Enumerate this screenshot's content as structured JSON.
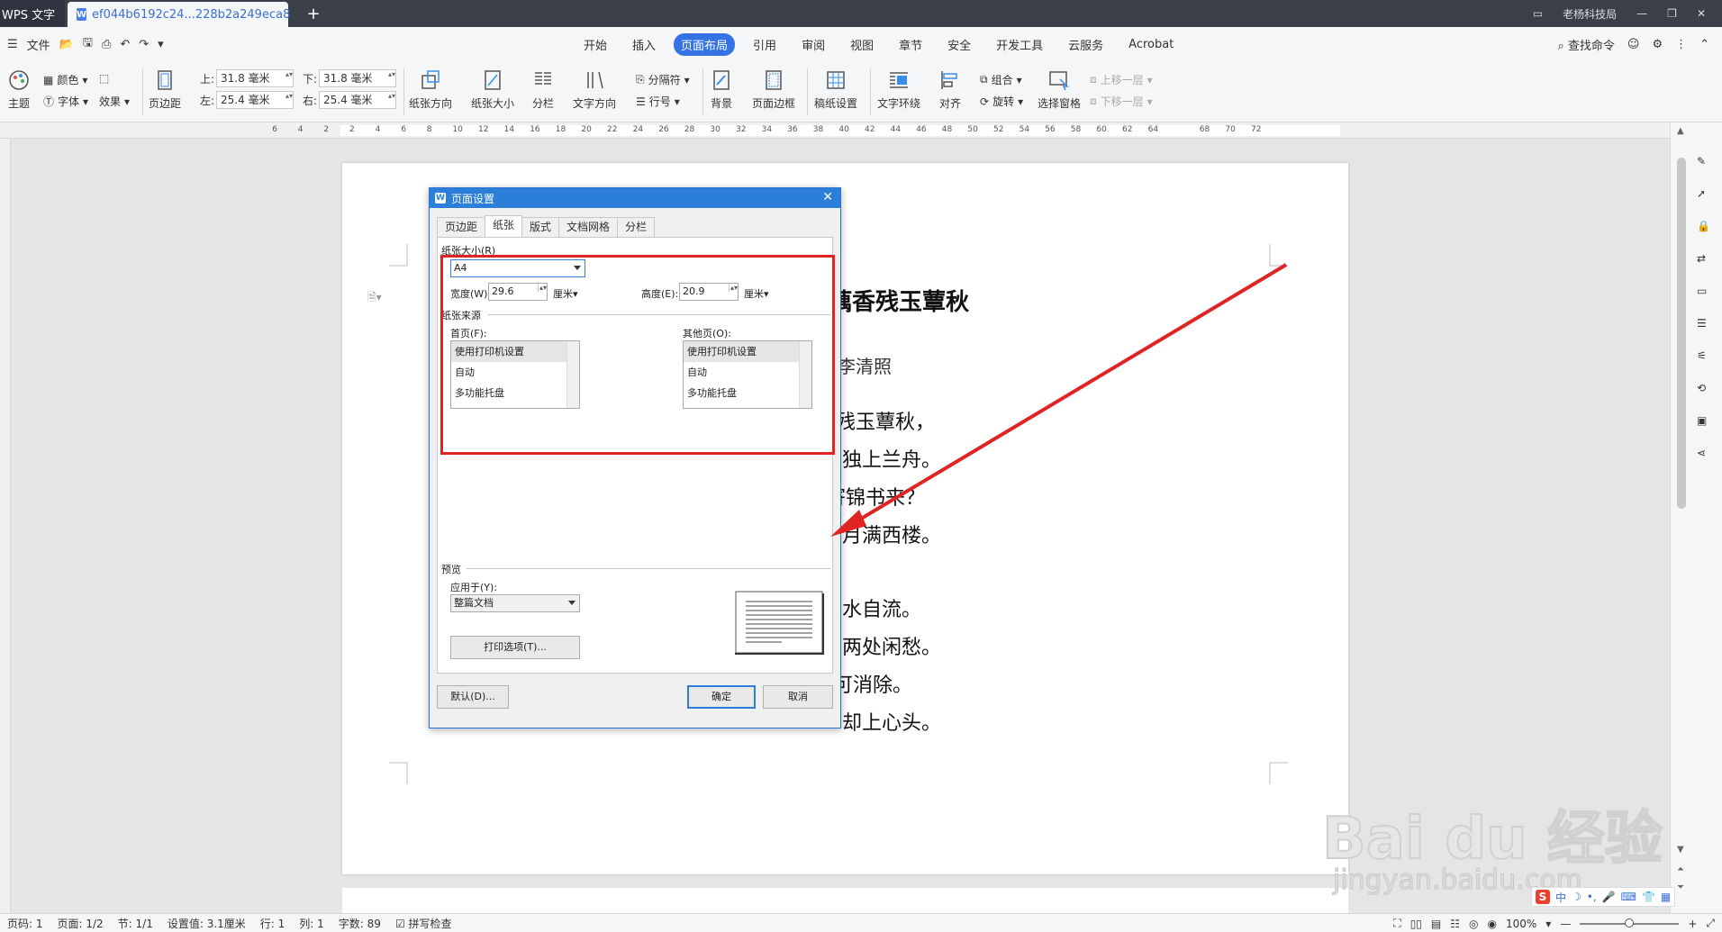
{
  "titlebar": {
    "app_tab": "WPS 文字",
    "doc_tab": "ef044b6192c24...228b2a249eca8",
    "user": "老杨科技局"
  },
  "menu": {
    "file": "文件",
    "tabs": [
      "开始",
      "插入",
      "页面布局",
      "引用",
      "审阅",
      "视图",
      "章节",
      "安全",
      "开发工具",
      "云服务",
      "Acrobat"
    ],
    "active_tab": "页面布局",
    "search": "查找命令"
  },
  "ribbon": {
    "theme": "主题",
    "color": "颜色",
    "font": "字体",
    "effect": "效果",
    "margins": "页边距",
    "top_label": "上:",
    "top_value": "31.8 毫米",
    "bottom_label": "下:",
    "bottom_value": "31.8 毫米",
    "left_label": "左:",
    "left_value": "25.4 毫米",
    "right_label": "右:",
    "right_value": "25.4 毫米",
    "orientation": "纸张方向",
    "size": "纸张大小",
    "columns": "分栏",
    "text_direction": "文字方向",
    "breaks": "分隔符",
    "line_numbers": "行号",
    "background": "背景",
    "page_border": "页面边框",
    "manuscript": "稿纸设置",
    "wrap": "文字环绕",
    "align": "对齐",
    "group": "组合",
    "rotate": "旋转",
    "selection_pane": "选择窗格",
    "bring_forward": "上移一层",
    "send_backward": "下移一层"
  },
  "ruler": {
    "numbers": [
      "6",
      "4",
      "2",
      "2",
      "4",
      "6",
      "8",
      "10",
      "12",
      "14",
      "16",
      "18",
      "20",
      "22",
      "24",
      "26",
      "28",
      "30",
      "32",
      "34",
      "36",
      "38",
      "40",
      "42",
      "44",
      "46",
      "48",
      "50",
      "52",
      "54",
      "56",
      "58",
      "60",
      "62",
      "64",
      "68",
      "70",
      "72"
    ]
  },
  "document": {
    "title": "藕香残玉蕈秋",
    "author": "李清照",
    "lines": [
      "残玉蕈秋，",
      "独上兰舟。",
      "寄锦书来？",
      "月满西楼。",
      "水自流。",
      "两处闲愁。",
      "可消除。",
      "却上心头。"
    ]
  },
  "dialog": {
    "title": "页面设置",
    "tabs": [
      "页边距",
      "纸张",
      "版式",
      "文档网格",
      "分栏"
    ],
    "active_tab": "纸张",
    "paper_size_label": "纸张大小(R)",
    "paper_size_value": "A4",
    "width_label": "宽度(W):",
    "width_value": "29.6",
    "width_unit": "厘米",
    "height_label": "高度(E):",
    "height_value": "20.9",
    "height_unit": "厘米",
    "paper_source_label": "纸张来源",
    "first_page_label": "首页(F):",
    "other_pages_label": "其他页(O):",
    "source_options": [
      "使用打印机设置",
      "自动",
      "多功能托盘"
    ],
    "preview_label": "预览",
    "apply_to_label": "应用于(Y):",
    "apply_to_value": "整篇文档",
    "print_options": "打印选项(T)...",
    "default_button": "默认(D)...",
    "ok_button": "确定",
    "cancel_button": "取消"
  },
  "status": {
    "page_num": "页码: 1",
    "pages": "页面: 1/2",
    "section": "节: 1/1",
    "setting": "设置值: 3.1厘米",
    "row": "行: 1",
    "col": "列: 1",
    "words": "字数: 89",
    "spell": "拼写检查",
    "zoom": "100%"
  },
  "watermark": {
    "text": "Bai du 经验",
    "url": "jingyan.baidu.com"
  },
  "colors": {
    "accent": "#3572e3",
    "dialog_title": "#2c7fd8",
    "highlight_red": "#e02424"
  }
}
